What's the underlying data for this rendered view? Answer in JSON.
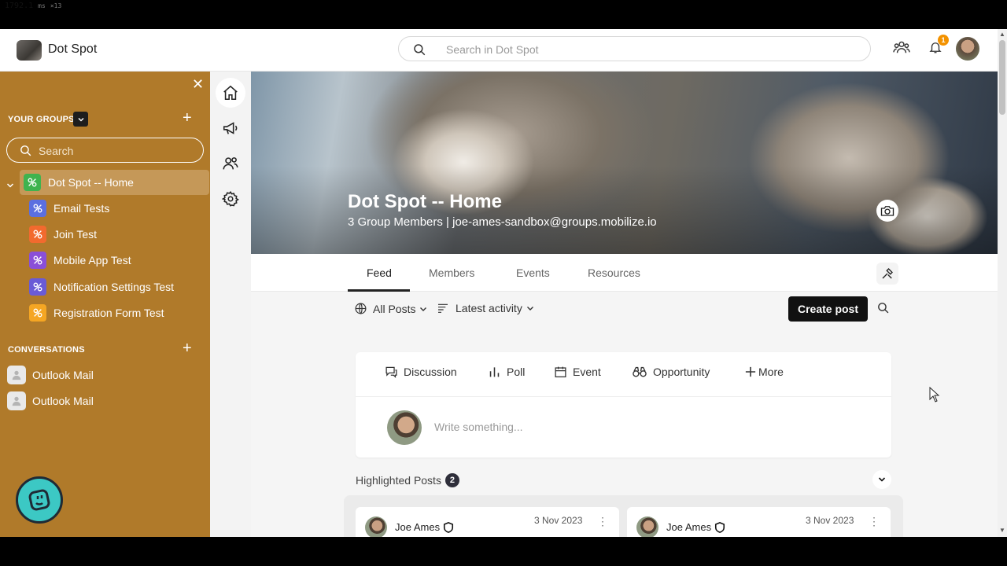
{
  "perf_overlay": {
    "value": "1792.1",
    "unit": "ms",
    "mult": "×13"
  },
  "header": {
    "app_title": "Dot Spot",
    "search_placeholder": "Search in Dot Spot",
    "notification_count": "1"
  },
  "sidebar": {
    "groups_heading": "YOUR GROUPS",
    "search_placeholder": "Search",
    "groups": [
      {
        "label": "Dot Spot -- Home",
        "color": "#3fb34f",
        "active": true
      },
      {
        "label": "Email Tests",
        "color": "#5b6fe0"
      },
      {
        "label": "Join Test",
        "color": "#f26a2e"
      },
      {
        "label": "Mobile App Test",
        "color": "#8a4fd8"
      },
      {
        "label": "Notification Settings Test",
        "color": "#6a5bd6"
      },
      {
        "label": "Registration Form Test",
        "color": "#f5a623"
      }
    ],
    "conversations_heading": "CONVERSATIONS",
    "conversations": [
      {
        "label": "Outlook Mail"
      },
      {
        "label": "Outlook Mail"
      }
    ]
  },
  "hero": {
    "title": "Dot Spot -- Home",
    "subtitle": "3 Group Members | joe-ames-sandbox@groups.mobilize.io"
  },
  "tabs": [
    {
      "label": "Feed",
      "active": true
    },
    {
      "label": "Members"
    },
    {
      "label": "Events"
    },
    {
      "label": "Resources"
    }
  ],
  "filters": {
    "posts": "All Posts",
    "sort": "Latest activity"
  },
  "create_post_label": "Create post",
  "composer": {
    "types": [
      {
        "label": "Discussion",
        "icon": "discussion-icon"
      },
      {
        "label": "Poll",
        "icon": "poll-icon"
      },
      {
        "label": "Event",
        "icon": "calendar-icon"
      },
      {
        "label": "Opportunity",
        "icon": "binoculars-icon"
      },
      {
        "label": "More",
        "icon": "plus-icon"
      }
    ],
    "placeholder": "Write something..."
  },
  "highlighted": {
    "title": "Highlighted Posts",
    "count": "2",
    "posts": [
      {
        "author": "Joe Ames",
        "date": "3 Nov 2023"
      },
      {
        "author": "Joe Ames",
        "date": "3 Nov 2023"
      }
    ]
  },
  "colors": {
    "sidebar_bg": "#b07a2a",
    "accent_dark": "#111111",
    "badge": "#f39200",
    "help_button": "#3cc8c4"
  }
}
